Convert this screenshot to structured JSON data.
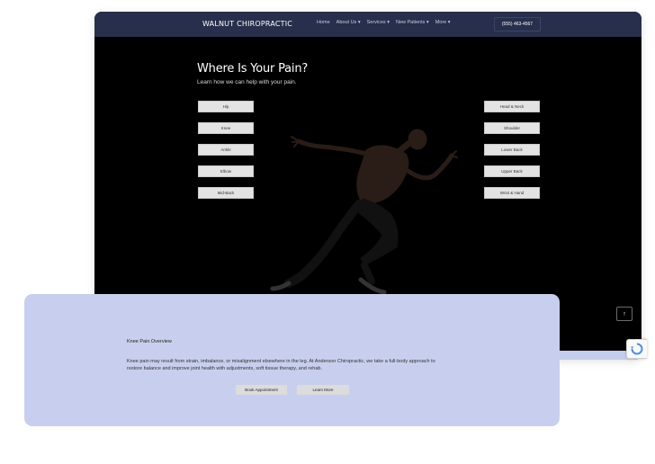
{
  "header": {
    "logo": "WALNUT CHIROPRACTIC",
    "menu": [
      "Home",
      "About Us ▾",
      "Services ▾",
      "New Patients ▾",
      "More ▾"
    ],
    "phone": "(555) 463-4567"
  },
  "hero": {
    "title": "Where Is Your Pain?",
    "subtitle": "Learn how we can help with your pain.",
    "left_buttons": [
      "Hip",
      "Knee",
      "Ankle",
      "Elbow",
      "Mid-Back"
    ],
    "right_buttons": [
      "Head & Neck",
      "Shoulder",
      "Lower Back",
      "Upper Back",
      "Wrist & Hand"
    ]
  },
  "scroll_top_icon": "↑",
  "overview": {
    "title": "Knee Pain Overview",
    "text": "Knee pain may result from strain, imbalance, or misalignment elsewhere in the leg. At Anderson Chiropractic, we take a full-body approach to restore balance and improve joint health with adjustments, soft tissue therapy, and rehab.",
    "book_label": "Book Appointment",
    "learn_label": "Learn More"
  },
  "icons": {
    "scroll_top": "arrow-up-icon",
    "captcha": "recaptcha-icon"
  },
  "colors": {
    "nav": "#272f4c",
    "hero_bg": "#000000",
    "card_bg": "#c8cfee"
  }
}
